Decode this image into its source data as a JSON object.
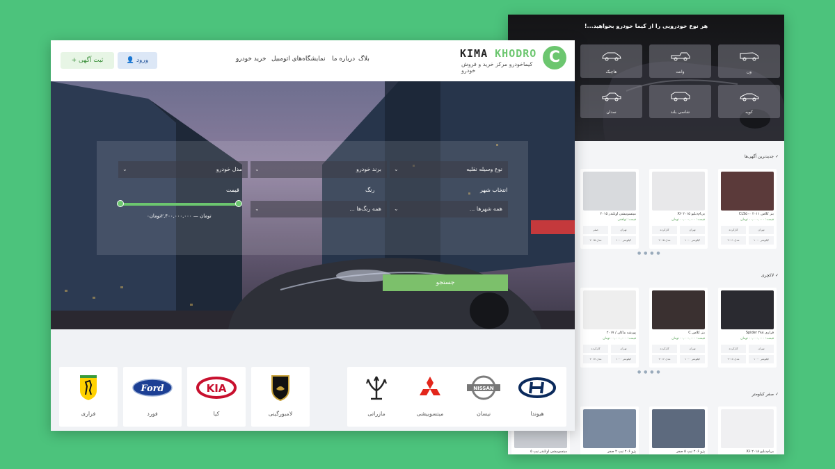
{
  "header": {
    "logo_letter": "C",
    "logo_brand_a": "KIMA",
    "logo_brand_b": "KHODRO",
    "logo_tagline": "کیماخودرو مرکز خرید و فروش خودرو",
    "nav": [
      "بلاگ",
      "درباره ما",
      "نمایشگاه‌های اتومبیل",
      "خرید خودرو"
    ],
    "login_label": "ورود",
    "post_ad_label": "+ ثبت آگهی"
  },
  "search": {
    "vehicle_type": "نوع وسیله نقلیه",
    "brand": "برند خودرو",
    "model": "مدل خودرو",
    "city_label": "انتخاب شهر",
    "color_label": "رنگ",
    "price_label": "قیمت",
    "cities": "همه شهرها ...",
    "colors": "همه رنگ‌ها ...",
    "price_range": "۰تومان — ۲,۴۰۰,۰۰۰,۰۰۰تومان",
    "search_button": "جستجو"
  },
  "brands": [
    {
      "name": "هیوندا",
      "logo": "hyundai-logo"
    },
    {
      "name": "نیسان",
      "logo": "nissan-logo"
    },
    {
      "name": "میتسوبیشی",
      "logo": "mitsubishi-logo"
    },
    {
      "name": "مازراتی",
      "logo": "maserati-logo"
    },
    {
      "name": "لامبورگینی",
      "logo": "lamborghini-logo"
    },
    {
      "name": "کیا",
      "logo": "kia-logo"
    },
    {
      "name": "فورد",
      "logo": "ford-logo"
    },
    {
      "name": "فراری",
      "logo": "ferrari-logo"
    }
  ],
  "right": {
    "title": "هر نوع خودرویی را از کیما خودرو بخواهید...!",
    "vehicle_types": [
      "ون",
      "وانت",
      "هاچبک",
      "کوپه",
      "شاسی بلند",
      "سدان"
    ],
    "sections": [
      {
        "title": "جدیدترین آگهی‌ها",
        "cards": [
          {
            "title": "بنز کلاس CLS۵۰۰ ۲۰۱۱",
            "price": "قیمت: ۰۰,۰۰۰,۰۰۰ تومان",
            "city": "تهران",
            "status": "کارکرده",
            "year": "مدل ۲۰۱۱",
            "km": "۱۰۰۰ کیلومتر",
            "photo": "#5b3a3a"
          },
          {
            "title": "بی‌ام‌دبلیو X۶ ۲۰۱۵",
            "price": "قیمت: ۰۰,۰۰۰,۰۰۰ تومان",
            "city": "تهران",
            "status": "کارکرده",
            "year": "مدل ۲۰۱۵",
            "km": "۱۰۰۰ کیلومتر",
            "photo": "#e8e8ea"
          },
          {
            "title": "میتسوبیشی اوتلندر ۲۰۱۵",
            "price": "قیمت: توافقی",
            "city": "تهران",
            "status": "صفر",
            "year": "مدل ۲۰۱۵",
            "km": "۱۰۰۰ کیلومتر",
            "photo": "#d8dadd"
          }
        ]
      },
      {
        "title": "لاکچری",
        "cards": [
          {
            "title": "فراری Spider ۴۸۸",
            "price": "قیمت: ۰۰,۰۰۰,۰۰۰ تومان",
            "city": "تهران",
            "status": "کارکرده",
            "year": "مدل ۲۰۱۸",
            "km": "۱۰۰۰ کیلومتر",
            "photo": "#2a2a30"
          },
          {
            "title": "بنز کلاس C",
            "price": "قیمت: ۰۰,۰۰۰,۰۰۰ تومان",
            "city": "تهران",
            "status": "کارکرده",
            "year": "مدل ۲۰۱۶",
            "km": "۱۰۰۰ کیلومتر",
            "photo": "#3a3030"
          },
          {
            "title": "پورشه ماکان / ۲۰۱۷",
            "price": "قیمت: ۰۰,۰۰۰,۰۰۰ تومان",
            "city": "تهران",
            "status": "کارکرده",
            "year": "مدل ۲۰۱۷",
            "km": "۱۰۰۰ کیلومتر",
            "photo": "#eeeeee"
          }
        ]
      },
      {
        "title": "صفر کیلومتر",
        "cards": [
          {
            "title": "بی‌ام‌دبلیو X۶ ۲۰۱۸",
            "photo": "#f0f0f2"
          },
          {
            "title": "پژو ۲۰۶ تیپ ۵ صفر",
            "photo": "#5d6a7e"
          },
          {
            "title": "پژو ۲۰۶ تیپ ۲ صفر",
            "photo": "#7a8aa0"
          },
          {
            "title": "میتسوبیشی اوتلندر تیپ ۵",
            "photo": "#c9ccd2"
          }
        ]
      }
    ]
  },
  "colors": {
    "accent": "#6cc66f",
    "background": "#4cc37c"
  }
}
